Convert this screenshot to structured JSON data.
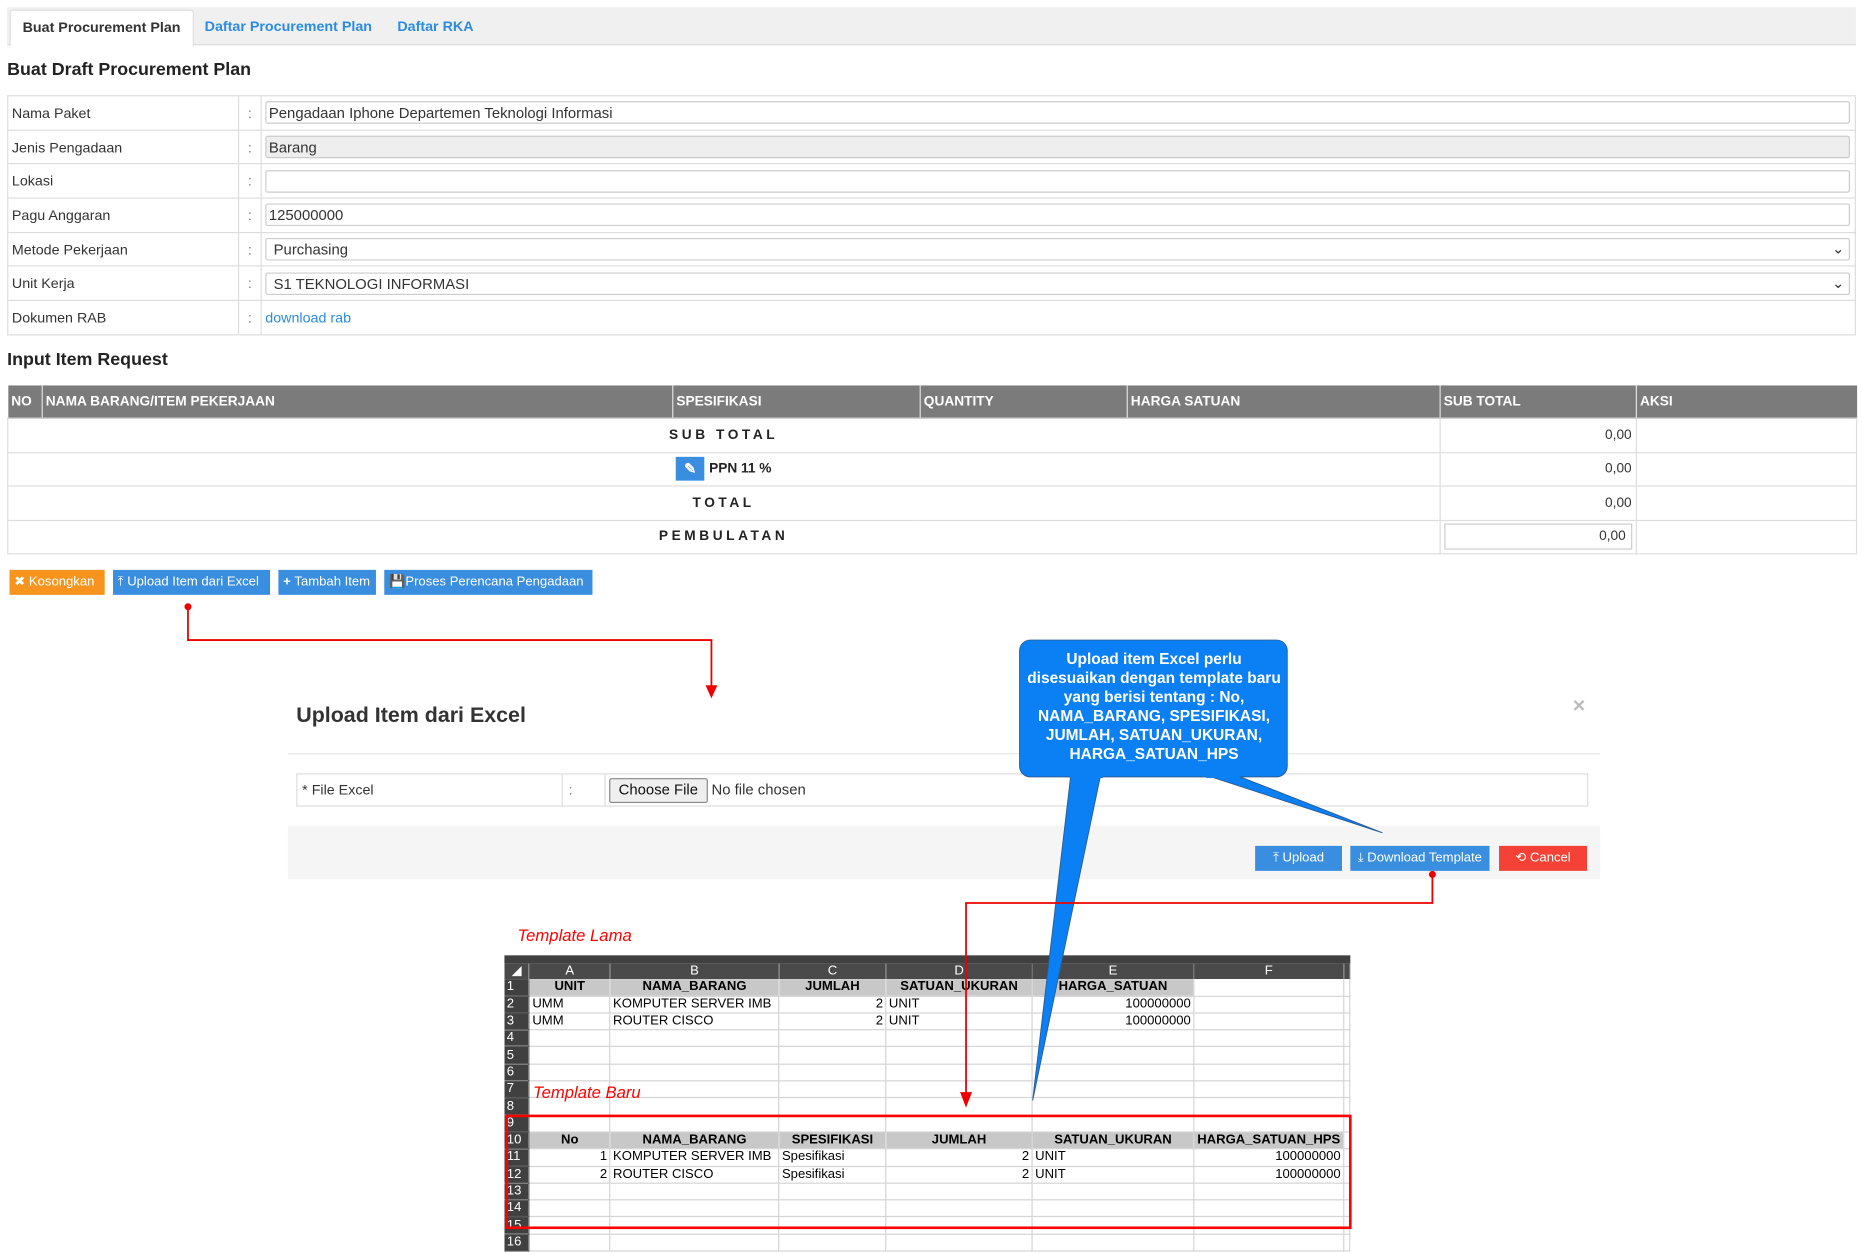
{
  "tabs": [
    {
      "label": "Buat Procurement Plan",
      "active": true
    },
    {
      "label": "Daftar Procurement Plan",
      "active": false
    },
    {
      "label": "Daftar RKA",
      "active": false
    }
  ],
  "page_title": "Buat Draft Procurement Plan",
  "form": {
    "separator": ":",
    "nama_paket": {
      "label": "Nama Paket",
      "value": "Pengadaan Iphone Departemen Teknologi Informasi"
    },
    "jenis_pengadaan": {
      "label": "Jenis Pengadaan",
      "value": "Barang"
    },
    "lokasi": {
      "label": "Lokasi",
      "value": ""
    },
    "pagu_anggaran": {
      "label": "Pagu Anggaran",
      "value": "125000000"
    },
    "metode_pekerjaan": {
      "label": "Metode Pekerjaan",
      "value": "Purchasing"
    },
    "unit_kerja": {
      "label": "Unit Kerja",
      "value": "S1 TEKNOLOGI INFORMASI"
    },
    "dokumen_rab": {
      "label": "Dokumen RAB",
      "link": "download rab"
    }
  },
  "items_section_title": "Input Item Request",
  "items_table": {
    "columns": [
      "NO",
      "NAMA BARANG/ITEM PEKERJAAN",
      "SPESIFIKASI",
      "QUANTITY",
      "HARGA SATUAN",
      "SUB TOTAL",
      "AKSI"
    ],
    "sub_total": {
      "label": "SUB TOTAL",
      "value": "0,00"
    },
    "ppn": {
      "label": "PPN 11 %",
      "value": "0,00"
    },
    "total": {
      "label": "TOTAL",
      "value": "0,00"
    },
    "pembulatan": {
      "label": "PEMBULATAN",
      "value": "0,00"
    }
  },
  "actions": {
    "kosongkan": "Kosongkan",
    "upload_excel": "Upload Item dari Excel",
    "tambah_item": "Tambah Item",
    "proses": "Proses Perencana Pengadaan"
  },
  "modal": {
    "title": "Upload Item dari Excel",
    "close": "×",
    "file_label": "* File Excel",
    "separator": ":",
    "choose_file": "Choose File",
    "no_file": "No file chosen",
    "upload": "Upload",
    "download_template": "Download Template",
    "cancel": "Cancel"
  },
  "callout": {
    "text": "Upload item Excel perlu disesuaikan dengan template baru yang berisi tentang : No, NAMA_BARANG, SPESIFIKASI, JUMLAH, SATUAN_UKURAN, HARGA_SATUAN_HPS"
  },
  "annotations": {
    "template_lama": "Template Lama",
    "template_baru": "Template Baru"
  },
  "spreadsheet": {
    "columns": [
      "A",
      "B",
      "C",
      "D",
      "E",
      "F"
    ],
    "rows": [
      {
        "n": "1",
        "style": "header",
        "gray": 5,
        "cells": [
          "UNIT",
          "NAMA_BARANG",
          "JUMLAH",
          "SATUAN_UKURAN",
          "HARGA_SATUAN",
          ""
        ]
      },
      {
        "n": "2",
        "cells": [
          "UMM",
          "KOMPUTER SERVER IMB",
          "2",
          "UNIT",
          "100000000",
          ""
        ]
      },
      {
        "n": "3",
        "cells": [
          "UMM",
          "ROUTER CISCO",
          "2",
          "UNIT",
          "100000000",
          ""
        ]
      },
      {
        "n": "4",
        "cells": [
          "",
          "",
          "",
          "",
          "",
          ""
        ]
      },
      {
        "n": "5",
        "cells": [
          "",
          "",
          "",
          "",
          "",
          ""
        ]
      },
      {
        "n": "6",
        "cells": [
          "",
          "",
          "",
          "",
          "",
          ""
        ]
      },
      {
        "n": "7",
        "cells": [
          "",
          "",
          "",
          "",
          "",
          ""
        ]
      },
      {
        "n": "8",
        "cells": [
          "",
          "",
          "",
          "",
          "",
          ""
        ]
      },
      {
        "n": "9",
        "cells": [
          "",
          "",
          "",
          "",
          "",
          ""
        ]
      },
      {
        "n": "10",
        "style": "header",
        "gray": 6,
        "cells": [
          "No",
          "NAMA_BARANG",
          "SPESIFIKASI",
          "JUMLAH",
          "SATUAN_UKURAN",
          "HARGA_SATUAN_HPS"
        ]
      },
      {
        "n": "11",
        "cells": [
          "1",
          "KOMPUTER SERVER IMB",
          "Spesifikasi",
          "2",
          "UNIT",
          "100000000"
        ]
      },
      {
        "n": "12",
        "cells": [
          "2",
          "ROUTER CISCO",
          "Spesifikasi",
          "2",
          "UNIT",
          "100000000"
        ]
      },
      {
        "n": "13",
        "cells": [
          "",
          "",
          "",
          "",
          "",
          ""
        ]
      },
      {
        "n": "14",
        "cells": [
          "",
          "",
          "",
          "",
          "",
          ""
        ]
      },
      {
        "n": "15",
        "cells": [
          "",
          "",
          "",
          "",
          "",
          ""
        ]
      },
      {
        "n": "16",
        "cells": [
          "",
          "",
          "",
          "",
          "",
          ""
        ]
      }
    ]
  },
  "colors": {
    "primary": "#3a8ee0",
    "warning": "#f7941d",
    "danger": "#f44336",
    "callout": "#0b80f5",
    "annotation": "#ff0000"
  }
}
